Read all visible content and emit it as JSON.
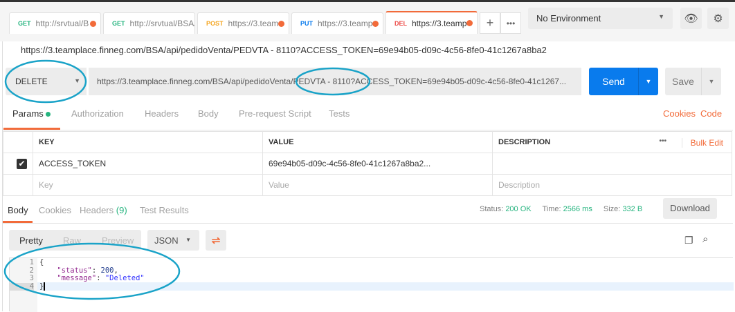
{
  "tabs": [
    {
      "method": "GET",
      "label": "http://srvtual/B",
      "color": "#26b47f"
    },
    {
      "method": "GET",
      "label": "http://srvtual/BSA/",
      "color": "#26b47f"
    },
    {
      "method": "POST",
      "label": "https://3.team",
      "color": "#f4a622"
    },
    {
      "method": "PUT",
      "label": "https://3.teamp",
      "color": "#097bed"
    },
    {
      "method": "DEL",
      "label": "https://3.teamp",
      "color": "#ed4b48"
    }
  ],
  "environment": "No Environment",
  "request_title": "https://3.teamplace.finneg.com/BSA/api/pedidoVenta/PEDVTA - 8110?ACCESS_TOKEN=69e94b05-d09c-4c56-8fe0-41c1267a8ba2",
  "method": "DELETE",
  "url": "https://3.teamplace.finneg.com/BSA/api/pedidoVenta/PEDVTA - 8110?ACCESS_TOKEN=69e94b05-d09c-4c56-8fe0-41c1267...",
  "send_label": "Send",
  "save_label": "Save",
  "request_tabs": [
    "Params",
    "Authorization",
    "Headers",
    "Body",
    "Pre-request Script",
    "Tests"
  ],
  "cookies_link": "Cookies",
  "code_link": "Code",
  "params": {
    "headers": [
      "KEY",
      "VALUE",
      "DESCRIPTION"
    ],
    "bulk_edit": "Bulk Edit",
    "rows": [
      {
        "key": "ACCESS_TOKEN",
        "value": "69e94b05-d09c-4c56-8fe0-41c1267a8ba2...",
        "checked": true
      }
    ],
    "placeholders": {
      "key": "Key",
      "value": "Value",
      "description": "Description"
    }
  },
  "response": {
    "tabs": [
      "Body",
      "Cookies",
      "Headers",
      "Test Results"
    ],
    "headers_count": "(9)",
    "status_label": "Status:",
    "status": "200 OK",
    "time_label": "Time:",
    "time": "2566 ms",
    "size_label": "Size:",
    "size": "332 B",
    "download": "Download",
    "views": [
      "Pretty",
      "Raw",
      "Preview"
    ],
    "format": "JSON",
    "lines": [
      "1",
      "2",
      "3",
      "4"
    ],
    "body": {
      "status_key": "\"status\"",
      "status_val": "200",
      "message_key": "\"message\"",
      "message_val": "\"Deleted\""
    }
  },
  "annotation_color": "#1aa3c8"
}
